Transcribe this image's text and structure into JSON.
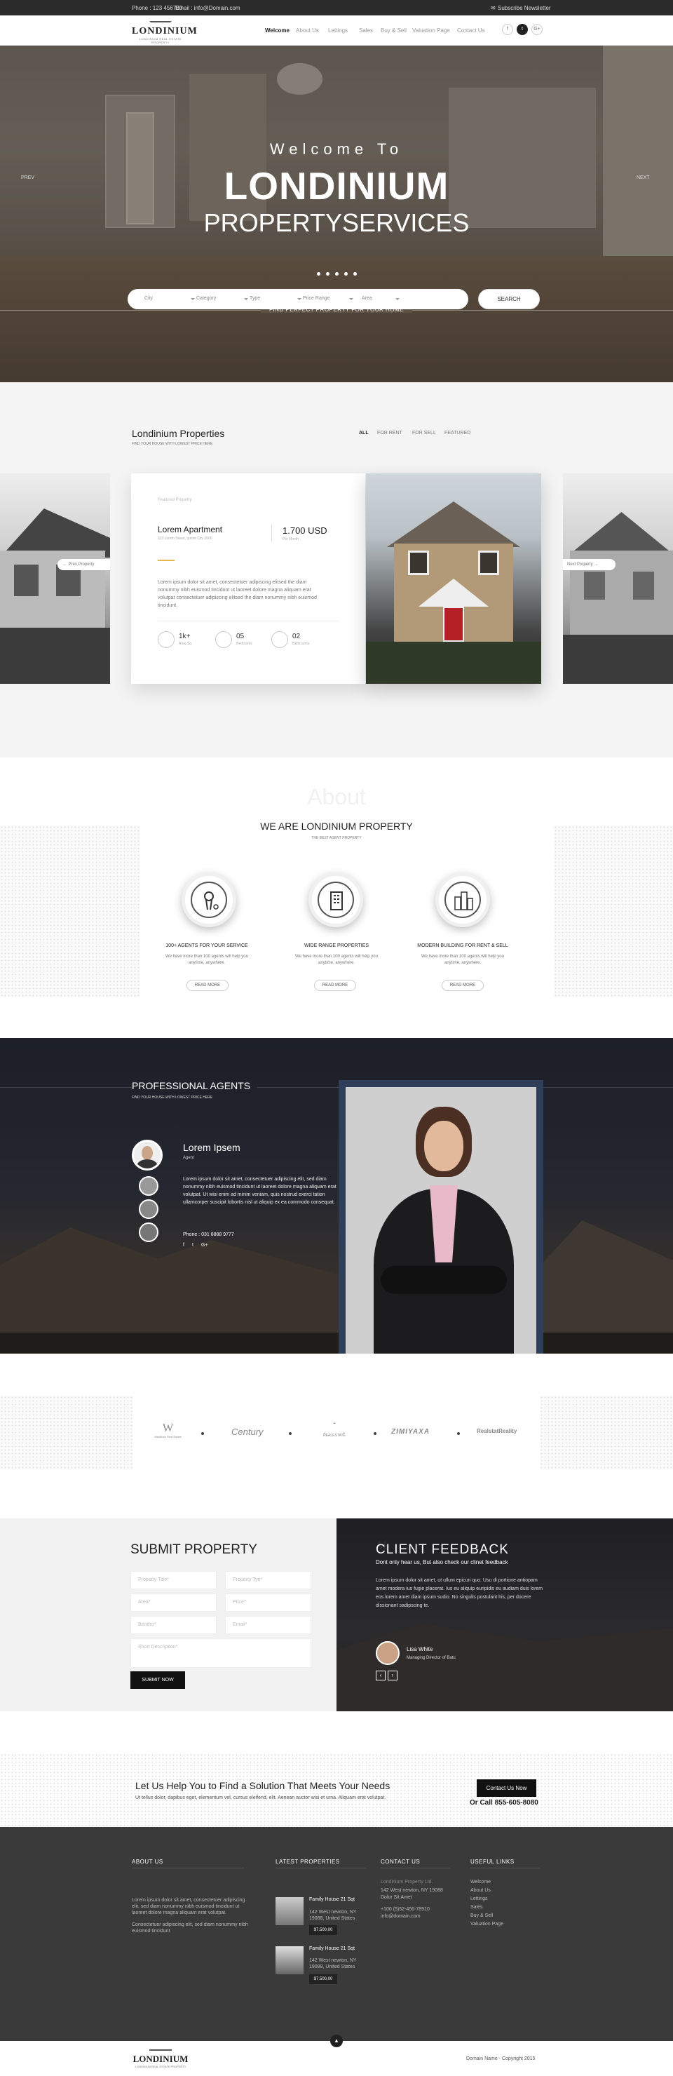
{
  "topbar": {
    "phone": "Phone : 123 456789",
    "email": "Email : info@Domain.com",
    "newsletter": "Subscribe Newsletter"
  },
  "header": {
    "logo": "LONDINIUM",
    "logo_tag": "LONDINIUM REAL ESTATE PROPERTY",
    "nav": [
      "Welcome",
      "About Us",
      "Lettings",
      "Sales",
      "Buy & Sell",
      "Valuation Page",
      "Contact Us"
    ],
    "social": [
      "f",
      "t",
      "G+"
    ]
  },
  "hero": {
    "welcome": "Welcome To",
    "title": "LONDINIUM",
    "subtitle": "PROPERTYSERVICES",
    "prev": "PREV",
    "next": "NEXT",
    "find": "FIND PERFECT PROPERTY FOR YOUR HOME",
    "fields": [
      "City",
      "Category",
      "Type",
      "Price Range",
      "Area"
    ],
    "search": "SEARCH"
  },
  "properties": {
    "title": "Londinium Properties",
    "subtitle": "FIND YOUR HOUSE WITH LOWEST PRICE HERE",
    "filters": [
      "ALL",
      "FOR RENT",
      "FOR SELL",
      "FEATURED"
    ],
    "card_label": "Featured Property",
    "name": "Lorem Apartment",
    "address": "123 Lorem Street, Ipsum City 1000",
    "price": "1.700 USD",
    "price_sub": "Per Month",
    "desc": "Lorem ipsum dolor sit amet, consectetuer adipiscing elitsed the diam nonummy nibh euismod tincidunt ut laoreet dolore magna aliquam erat volutpat consectetuer adipiscing elitsed the diam nonummy nibh euismod tincidunt.",
    "stats": [
      {
        "num": "1k+",
        "label": "Area Sq"
      },
      {
        "num": "05",
        "label": "Bedrooms"
      },
      {
        "num": "02",
        "label": "Bathrooms"
      }
    ],
    "prev": "Prev Property",
    "next": "Next Property"
  },
  "about": {
    "watermark": "About",
    "title": "WE ARE LONDINIUM PROPERTY",
    "subtitle": "THE BEST AGENT PROPERTY",
    "features": [
      {
        "title": "100+ AGENTS FOR YOUR SERVICE",
        "text": "We have more than 100 agents will help you anytime, anywhere.",
        "btn": "READ MORE"
      },
      {
        "title": "WIDE RANGE PROPERTIES",
        "text": "We have more than 100 agents will help you anytime, anywhere.",
        "btn": "READ MORE"
      },
      {
        "title": "MODERN BUILDING FOR RENT & SELL",
        "text": "We have more than 100 agents will help you anytime, anywhere.",
        "btn": "READ MORE"
      }
    ]
  },
  "agents": {
    "title": "PROFESSIONAL AGENTS",
    "subtitle": "FIND YOUR HOUSE WITH LOWEST PRICE HERE",
    "name": "Lorem Ipsem",
    "role": "Agent",
    "bio": "Lorem ipsum dolor sit amet, consectetuer adipiscing elit, sed diam nonummy nibh euismod tincidunt ut laoreet dolore magna aliquam erat volutpat. Ut wisi enim ad minim veniam, quis nostrud exerci tation ullamcorper suscipit lobortis nisl ut aliquip ex ea commodo consequat.",
    "phone": "Phone : 031 8888 9777",
    "social": [
      "f",
      "t",
      "G+"
    ]
  },
  "partners": [
    "Westbury Real Estate",
    "Century",
    "REALESTATE",
    "ZIMIYAXA",
    "RealstatReality"
  ],
  "submit": {
    "title": "SUBMIT PROPERTY",
    "fields": [
      "Property Title*",
      "Property Tye*",
      "Area*",
      "Price*",
      "Bendro*",
      "Email*"
    ],
    "desc": "Short Description*",
    "btn": "SUBMIT NOW"
  },
  "feedback": {
    "title": "CLIENT FEEDBACK",
    "subtitle": "Dont only hear us, But also check our clinet feedback",
    "quote": "Lorem ipsum dolor sit amet, ut ullum epicuri quo. Usu di portione antiopam amet modera ius fugie placerat. Ius eu aliquip euripidis eu audiam duis lorem eos lorem amet diam ipsum sudio. No singulis postulant his, per docere dissionant sadipscing te.",
    "name": "Lisa White",
    "role": "Managing Director of  Batu"
  },
  "cta": {
    "title": "Let Us Help You to Find a Solution That Meets Your Needs",
    "text": "Ut tellus dolor, dapibus eget, elementum vel, cursus eleifend, elit. Aenean auctor wisi et urna. Aliquam erat volutpat.",
    "btn": "Contact Us Now",
    "phone": "Or Call 855-605-8080"
  },
  "footer": {
    "about_title": "ABOUT US",
    "about_text": "Lorem ipsum dolor sit amet, consectetuer adipiscing elit, sed diam nonummy nibh euismod tincidunt ut laoreet dolore magna aliquam erat volutpat.",
    "about_text2": "Consectetuer adipiscing elit, sed diam nonummy nibh euismod tincidunt",
    "latest_title": "LATEST PROPERTIES",
    "latest": [
      {
        "name": "Family House 21 Sqt",
        "addr": "142 West newton, NY 19088, United States",
        "price": "$7.500,00"
      },
      {
        "name": "Family House 21 Sqt",
        "addr": "142 West newton, NY 19088, United States",
        "price": "$7.500,00"
      }
    ],
    "contact_title": "CONTACT US",
    "contact": [
      "Londinium Property Ltd.",
      "142 West newton, NY 19088",
      "Dolor Sit Amet",
      "+100 (5)52-456-78910",
      "info@domain.com"
    ],
    "links_title": "USEFUL LINKS",
    "links": [
      "Welcome",
      "About Us",
      "Lettings",
      "Sales",
      "Buy & Sell",
      "Valuation Page"
    ],
    "copyright": "Domain Name - Copyright 2015"
  }
}
